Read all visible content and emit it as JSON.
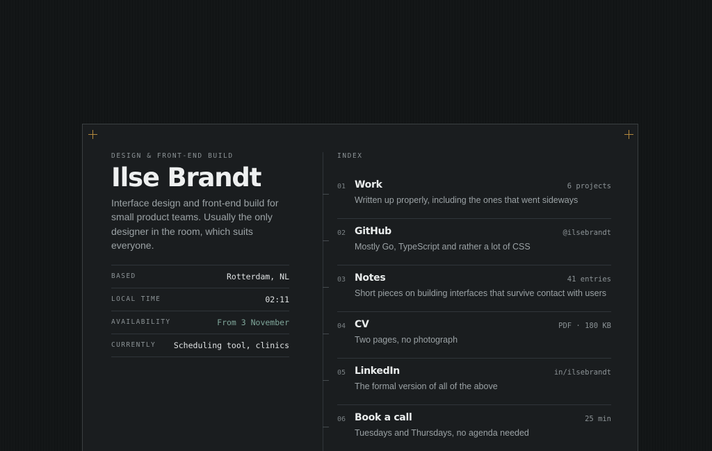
{
  "profile": {
    "kicker": "DESIGN & FRONT-END BUILD",
    "name": "Ilse Brandt",
    "bio": "Interface design and front-end build for small product teams. Usually the only designer in the room, which suits everyone.",
    "facts": [
      {
        "label": "BASED",
        "value": "Rotterdam, NL"
      },
      {
        "label": "LOCAL TIME",
        "value": "02:11"
      },
      {
        "label": "AVAILABILITY",
        "value": "From 3 November"
      },
      {
        "label": "CURRENTLY",
        "value": "Scheduling tool, clinics"
      }
    ]
  },
  "index": {
    "label": "INDEX",
    "items": [
      {
        "num": "01",
        "title": "Work",
        "meta": "6 projects",
        "desc": "Written up properly, including the ones that went sideways"
      },
      {
        "num": "02",
        "title": "GitHub",
        "meta": "@ilsebrandt",
        "desc": "Mostly Go, TypeScript and rather a lot of CSS"
      },
      {
        "num": "03",
        "title": "Notes",
        "meta": "41 entries",
        "desc": "Short pieces on building interfaces that survive contact with users"
      },
      {
        "num": "04",
        "title": "CV",
        "meta": "PDF · 180 KB",
        "desc": "Two pages, no photograph"
      },
      {
        "num": "05",
        "title": "LinkedIn",
        "meta": "in/ilsebrandt",
        "desc": "The formal version of all of the above"
      },
      {
        "num": "06",
        "title": "Book a call",
        "meta": "25 min",
        "desc": "Tuesdays and Thursdays, no agenda needed"
      }
    ]
  },
  "colors": {
    "background": "#121516",
    "card": "#1a1d1f",
    "accent_crosshair": "#b4893d",
    "availability_accent": "#7fa69a"
  },
  "icons": [
    "crosshair-icon"
  ]
}
